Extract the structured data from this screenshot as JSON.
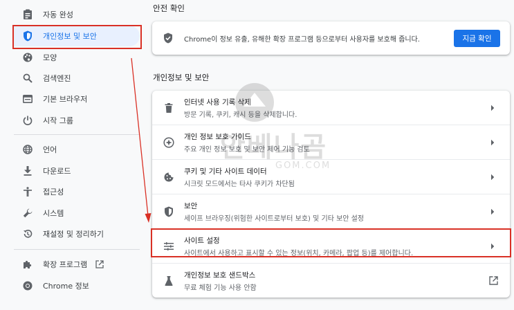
{
  "sidebar": {
    "items": [
      {
        "label": "자동 완성",
        "icon": "assignment-icon"
      },
      {
        "label": "개인정보 및 보안",
        "icon": "shield-icon"
      },
      {
        "label": "모양",
        "icon": "palette-icon"
      },
      {
        "label": "검색엔진",
        "icon": "search-icon"
      },
      {
        "label": "기본 브라우저",
        "icon": "browser-window-icon"
      },
      {
        "label": "시작 그룹",
        "icon": "power-icon"
      },
      {
        "label": "언어",
        "icon": "globe-icon"
      },
      {
        "label": "다운로드",
        "icon": "download-icon"
      },
      {
        "label": "접근성",
        "icon": "accessibility-icon"
      },
      {
        "label": "시스템",
        "icon": "wrench-icon"
      },
      {
        "label": "재설정 및 정리하기",
        "icon": "restore-icon"
      },
      {
        "label": "확장 프로그램",
        "icon": "puzzle-icon"
      },
      {
        "label": "Chrome 정보",
        "icon": "chrome-icon"
      }
    ]
  },
  "safety_check": {
    "title": "안전 확인",
    "text": "Chrome이 정보 유출, 유해한 확장 프로그램 등으로부터 사용자를 보호해 줍니다.",
    "button": "지금 확인"
  },
  "privacy": {
    "title": "개인정보 및 보안",
    "rows": [
      {
        "title": "인터넷 사용 기록 삭제",
        "subtitle": "방문 기록, 쿠키, 캐시 등을 삭제합니다.",
        "icon": "trash-icon"
      },
      {
        "title": "개인 정보 보호 가이드",
        "subtitle": "주요 개인 정보 보호 및 보안 제어 기능 검토",
        "icon": "compass-icon"
      },
      {
        "title": "쿠키 및 기타 사이트 데이터",
        "subtitle": "시크릿 모드에서는 타사 쿠키가 차단됨",
        "icon": "cookie-icon"
      },
      {
        "title": "보안",
        "subtitle": "세이프 브라우징(위험한 사이트로부터 보호) 및 기타 보안 설정",
        "icon": "shield-icon"
      },
      {
        "title": "사이트 설정",
        "subtitle": "사이트에서 사용하고 표시할 수 있는 정보(위치, 카메라, 팝업 등)를 제어합니다.",
        "icon": "tune-icon"
      },
      {
        "title": "개인정보 보호 샌드박스",
        "subtitle": "무료 체험 기능 사용 안함",
        "icon": "flask-icon"
      }
    ]
  },
  "watermark": {
    "text": "안베나곰",
    "sub": "GOM.COM"
  },
  "colors": {
    "accent": "#1a73e8",
    "highlight": "#d93025",
    "active_bg": "#e8f0fe"
  }
}
